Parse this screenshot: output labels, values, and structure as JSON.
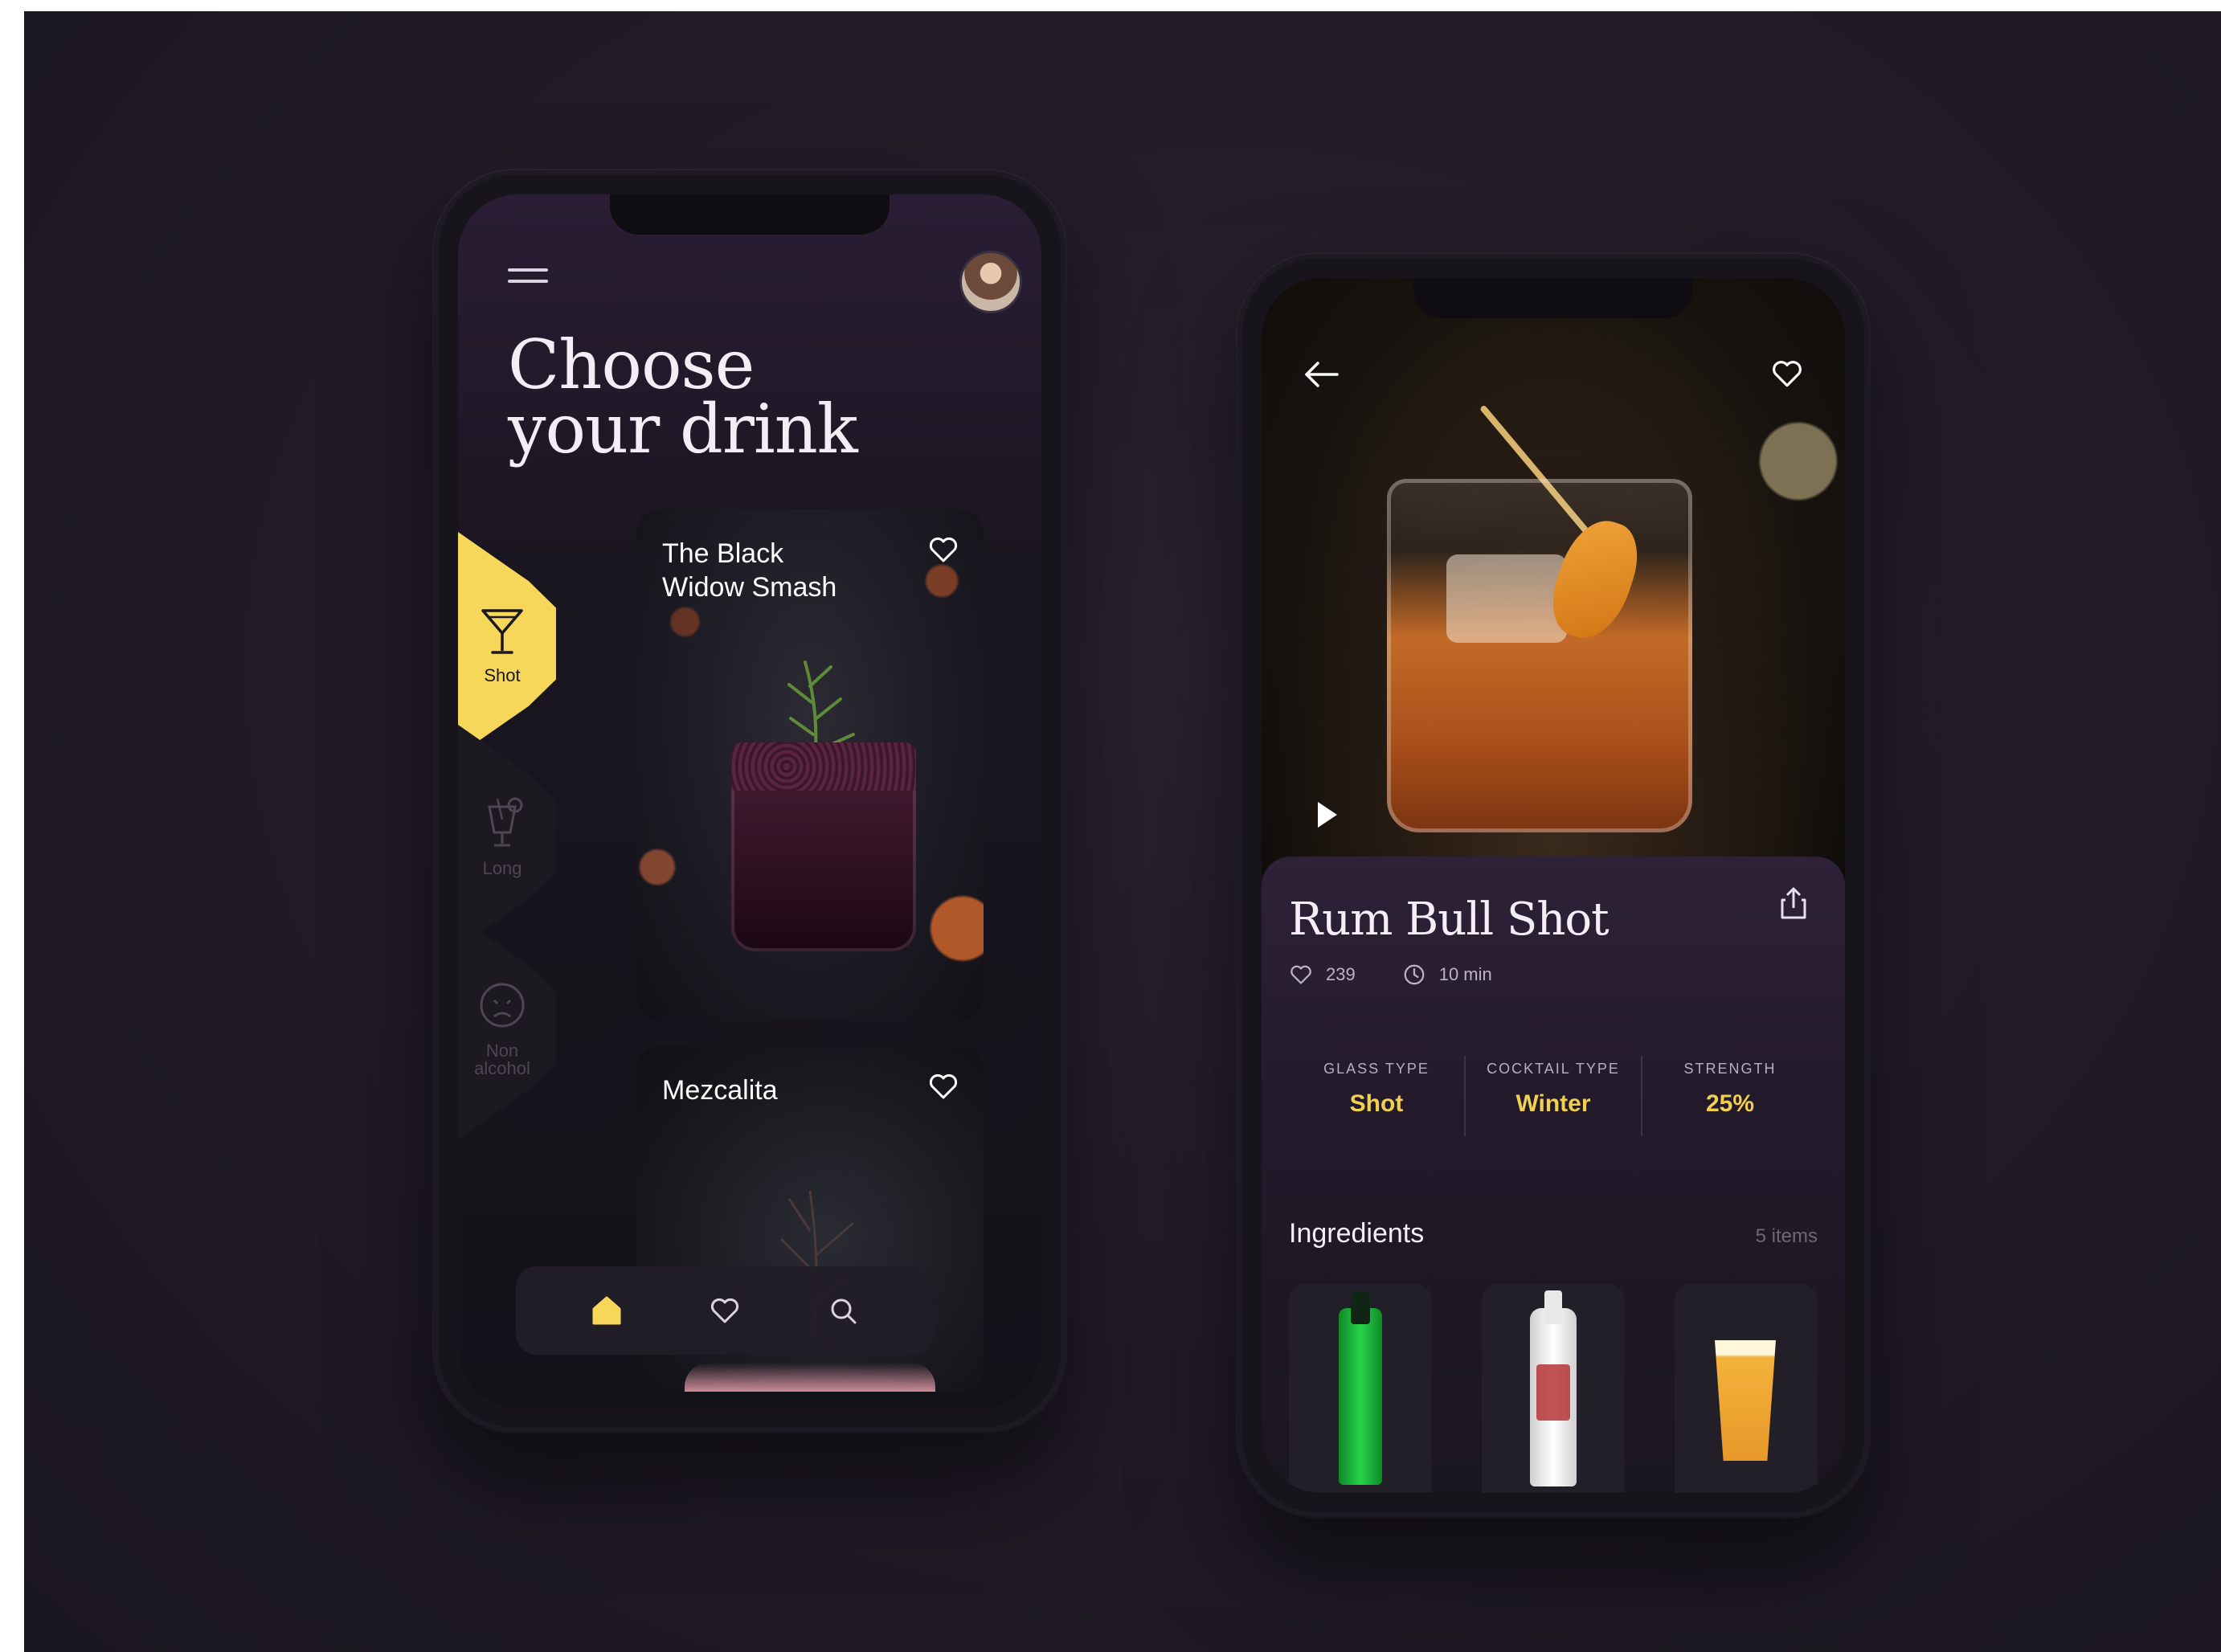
{
  "left_screen": {
    "title": "Choose\nyour drink",
    "categories": [
      {
        "label": "Shot",
        "icon": "martini-glass-icon",
        "active": true
      },
      {
        "label": "Long",
        "icon": "long-drink-icon",
        "active": false
      },
      {
        "label": "Non\nalcohol",
        "icon": "sad-face-icon",
        "active": false
      }
    ],
    "cards": [
      {
        "title": "The Black\nWidow Smash",
        "icon": "heart-icon"
      },
      {
        "title": "Mezcalita",
        "icon": "heart-icon"
      }
    ],
    "bottom_nav": [
      {
        "icon": "home-icon",
        "active": true
      },
      {
        "icon": "heart-icon",
        "active": false
      },
      {
        "icon": "search-icon",
        "active": false
      }
    ]
  },
  "right_screen": {
    "drink_name": "Rum Bull Shot",
    "likes": "239",
    "time": "10 min",
    "specs": [
      {
        "key": "GLASS TYPE",
        "value": "Shot"
      },
      {
        "key": "COCKTAIL TYPE",
        "value": "Winter"
      },
      {
        "key": "STRENGTH",
        "value": "25%"
      }
    ],
    "ingredients_title": "Ingredients",
    "ingredients_count": "5 items",
    "ingredients": [
      {
        "icon": "green-liqueur-bottle"
      },
      {
        "icon": "rum-bottle"
      },
      {
        "icon": "beer-glass"
      }
    ]
  },
  "colors": {
    "accent": "#f6d75a",
    "accent_text": "#f2cf4e",
    "background": "#221c28",
    "screen": "#1a1620"
  }
}
